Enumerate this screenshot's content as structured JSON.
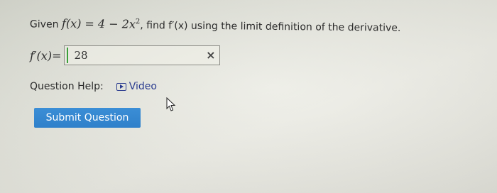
{
  "question": {
    "given": "Given",
    "function": "f(x) = 4 − 2x",
    "exponent": "2",
    "rest": ", find f′(x) using the limit definition of the derivative."
  },
  "answer": {
    "label": "f′(x)=",
    "value": "28",
    "clear_icon": "×"
  },
  "help": {
    "label": "Question Help:",
    "video_label": "Video"
  },
  "submit": {
    "label": "Submit Question"
  },
  "colors": {
    "button": "#2f80ca",
    "link": "#2a3b8f",
    "marker": "#3aa03a"
  }
}
